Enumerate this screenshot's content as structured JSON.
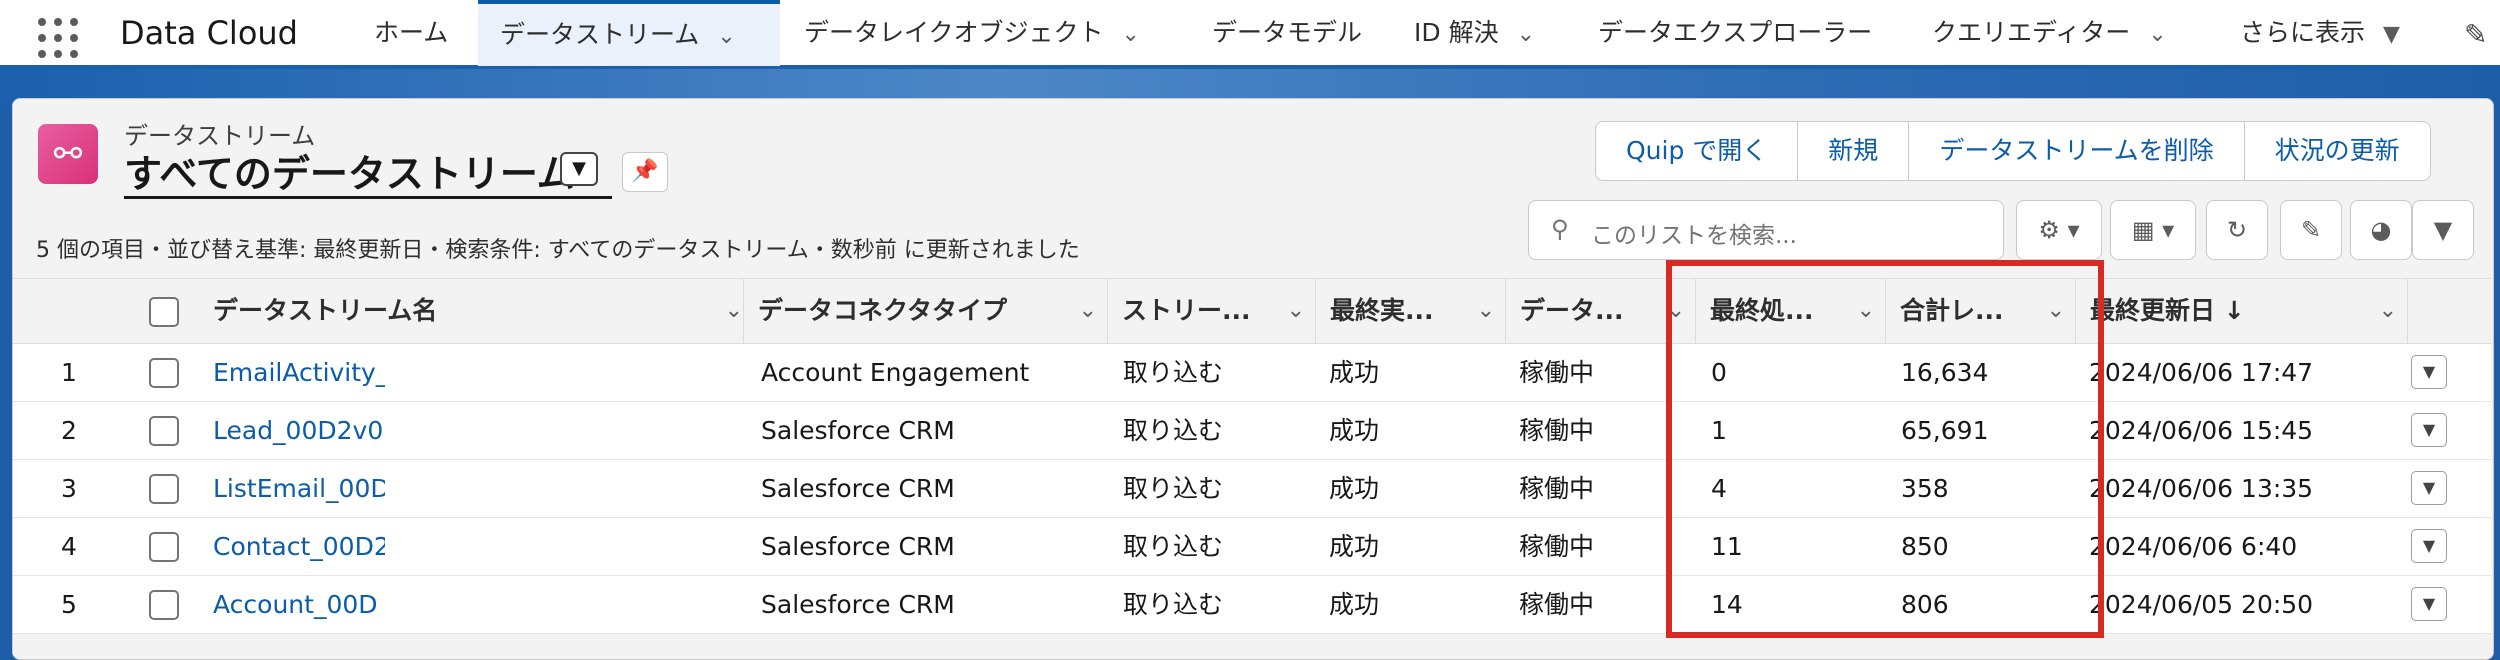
{
  "app": {
    "name": "Data Cloud"
  },
  "nav": {
    "items": [
      {
        "label": "ホーム"
      },
      {
        "label": "データストリーム"
      },
      {
        "label": "データレイクオブジェクト"
      },
      {
        "label": "データモデル"
      },
      {
        "label": "ID 解決"
      },
      {
        "label": "データエクスプローラー"
      },
      {
        "label": "クエリエディター"
      },
      {
        "label": "さらに表示"
      }
    ]
  },
  "header": {
    "object_label": "データストリーム",
    "list_view_title": "すべてのデータストリーム"
  },
  "actions": {
    "open_quip": "Quip で開く",
    "new": "新規",
    "delete": "データストリームを削除",
    "refresh_status": "状況の更新"
  },
  "status_text": "5 個の項目・並び替え基準: 最終更新日・検索条件: すべてのデータストリーム・数秒前 に更新されました",
  "search": {
    "placeholder": "このリストを検索..."
  },
  "table": {
    "headers": {
      "name": "データストリーム名",
      "connector_type": "データコネクタタイプ",
      "stream_type": "ストリー...",
      "last_run": "最終実...",
      "data_status": "データ...",
      "last_processed": "最終処...",
      "total_records": "合計レ...",
      "last_modified": "最終更新日 ↓"
    },
    "rows": [
      {
        "num": "1",
        "name": "EmailActivity_",
        "connector": "Account Engagement",
        "stream": "取り込む",
        "last_run": "成功",
        "data_status": "稼働中",
        "last_processed": "0",
        "total": "16,634",
        "modified": "2024/06/06 17:47"
      },
      {
        "num": "2",
        "name": "Lead_00D2v0",
        "connector": "Salesforce CRM",
        "stream": "取り込む",
        "last_run": "成功",
        "data_status": "稼働中",
        "last_processed": "1",
        "total": "65,691",
        "modified": "2024/06/06 15:45"
      },
      {
        "num": "3",
        "name": "ListEmail_00D",
        "connector": "Salesforce CRM",
        "stream": "取り込む",
        "last_run": "成功",
        "data_status": "稼働中",
        "last_processed": "4",
        "total": "358",
        "modified": "2024/06/06 13:35"
      },
      {
        "num": "4",
        "name": "Contact_00D2",
        "connector": "Salesforce CRM",
        "stream": "取り込む",
        "last_run": "成功",
        "data_status": "稼働中",
        "last_processed": "11",
        "total": "850",
        "modified": "2024/06/06 6:40"
      },
      {
        "num": "5",
        "name": "Account_00D",
        "connector": "Salesforce CRM",
        "stream": "取り込む",
        "last_run": "成功",
        "data_status": "稼働中",
        "last_processed": "14",
        "total": "806",
        "modified": "2024/06/05 20:50"
      }
    ]
  },
  "colors": {
    "brand": "#0b5cab",
    "highlight": "#d42b26",
    "object_icon": "#d9317a"
  }
}
